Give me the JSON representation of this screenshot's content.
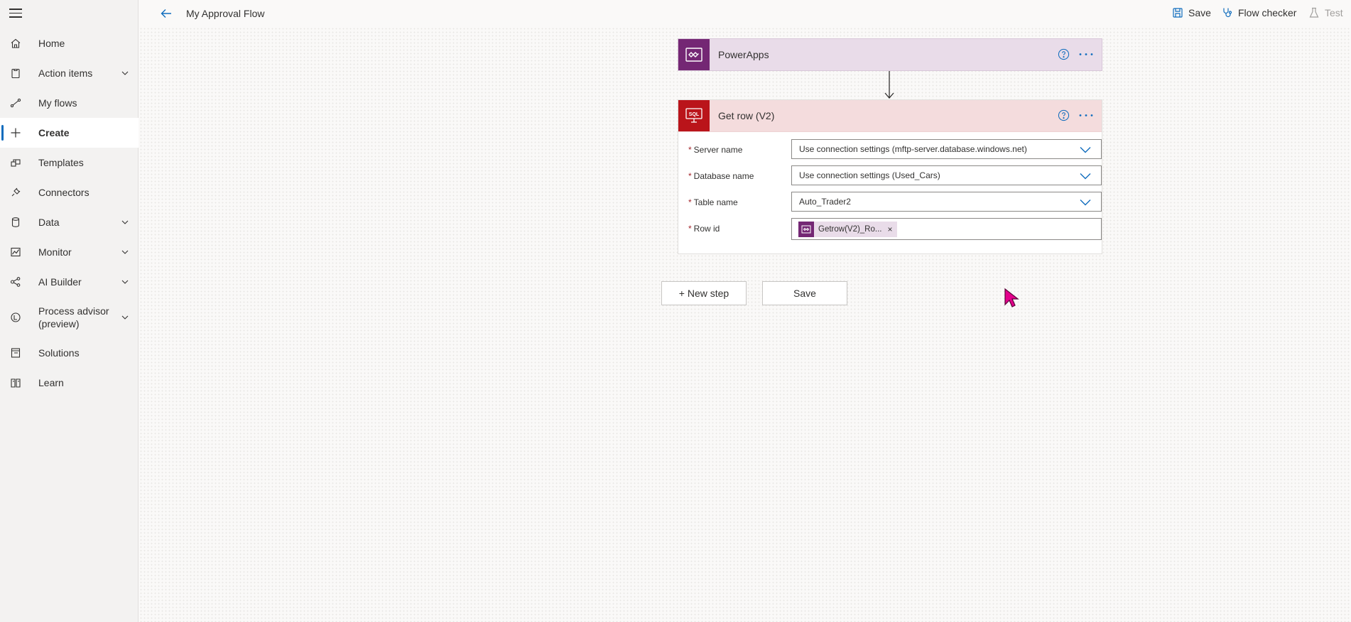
{
  "header": {
    "flow_title": "My Approval Flow",
    "commands": [
      {
        "label": "Save",
        "icon": "save-icon"
      },
      {
        "label": "Flow checker",
        "icon": "stethoscope-icon"
      },
      {
        "label": "Test",
        "icon": "flask-icon",
        "disabled": true
      }
    ]
  },
  "sidebar": {
    "items": [
      {
        "label": "Home",
        "icon": "home-icon"
      },
      {
        "label": "Action items",
        "icon": "clipboard-icon",
        "expandable": true
      },
      {
        "label": "My flows",
        "icon": "flow-icon"
      },
      {
        "label": "Create",
        "icon": "plus-icon",
        "selected": true
      },
      {
        "label": "Templates",
        "icon": "templates-icon"
      },
      {
        "label": "Connectors",
        "icon": "plug-icon"
      },
      {
        "label": "Data",
        "icon": "database-icon",
        "expandable": true
      },
      {
        "label": "Monitor",
        "icon": "chart-icon",
        "expandable": true
      },
      {
        "label": "AI Builder",
        "icon": "ai-icon",
        "expandable": true
      },
      {
        "label": "Process advisor (preview)",
        "icon": "process-icon",
        "expandable": true
      },
      {
        "label": "Solutions",
        "icon": "solutions-icon"
      },
      {
        "label": "Learn",
        "icon": "book-icon"
      }
    ]
  },
  "flow": {
    "trigger": {
      "title": "PowerApps"
    },
    "action": {
      "title": "Get row (V2)",
      "icon_text": "SQL",
      "fields": [
        {
          "label": "Server name",
          "value": "Use connection settings (mftp-server.database.windows.net)",
          "type": "dropdown"
        },
        {
          "label": "Database name",
          "value": "Use connection settings (Used_Cars)",
          "type": "dropdown"
        },
        {
          "label": "Table name",
          "value": "Auto_Trader2",
          "type": "dropdown"
        },
        {
          "label": "Row id",
          "token": "Getrow(V2)_Ro...",
          "type": "token"
        }
      ],
      "required_marker": "*"
    },
    "buttons": {
      "new_step": "+ New step",
      "save": "Save"
    }
  },
  "colors": {
    "powerapps": "#742774",
    "sql": "#ba141a",
    "accent": "#0f6cbd",
    "cursor": "#e3008c"
  }
}
